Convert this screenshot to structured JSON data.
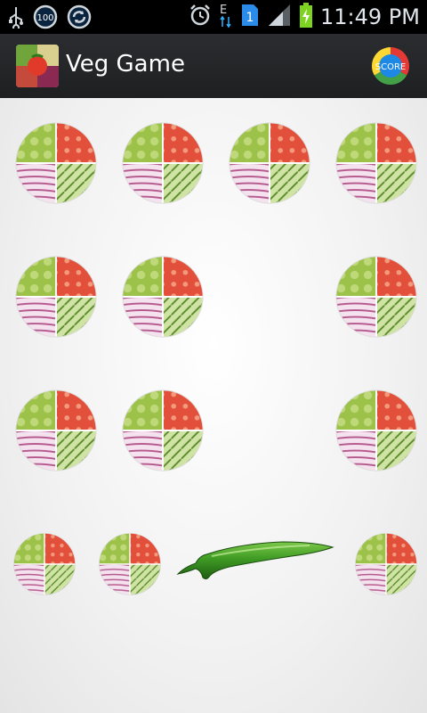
{
  "status_bar": {
    "time": "11:49 PM",
    "battery_saver_badge": "100",
    "network_type": "E",
    "sim_slot": "1"
  },
  "app": {
    "title": "Veg Game",
    "score_label": "SCORE"
  },
  "board": {
    "rows": [
      [
        "veg-tile",
        "veg-tile",
        "veg-tile",
        "veg-tile"
      ],
      [
        "veg-tile",
        "veg-tile",
        "empty",
        "veg-tile"
      ],
      [
        "veg-tile",
        "veg-tile",
        "empty",
        "veg-tile"
      ],
      [
        "veg-tile",
        "veg-tile",
        "chili-pepper",
        "veg-tile"
      ]
    ]
  },
  "colors": {
    "action_bar": "#232527",
    "status_bar": "#000000",
    "board_bg": "#f2f2f2"
  }
}
